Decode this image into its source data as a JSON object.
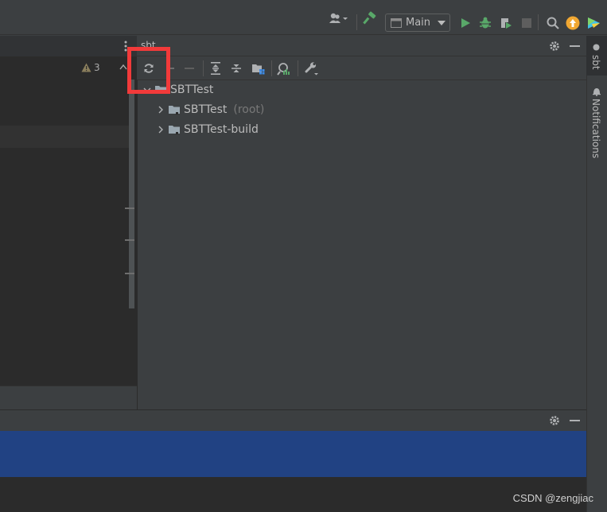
{
  "toolbar": {
    "run_config": "Main",
    "icons": [
      "user-icon",
      "build-hammer-icon",
      "run-icon",
      "debug-icon",
      "coverage-icon",
      "stop-icon",
      "search-icon",
      "update-icon",
      "jetbrains-icon"
    ]
  },
  "editor": {
    "warning_count": "3"
  },
  "sbt_panel": {
    "title": "sbt",
    "tree": {
      "root": "SBTTest",
      "children": [
        {
          "label": "SBTTest",
          "suffix": "(root)"
        },
        {
          "label": "SBTTest-build",
          "suffix": ""
        }
      ]
    }
  },
  "right_strip": {
    "tabs": [
      "sbt",
      "Notifications"
    ]
  },
  "watermark": "CSDN @zengjiac",
  "colors": {
    "highlight": "#f23a3a",
    "selection": "#214283",
    "run_green": "#59a869"
  }
}
